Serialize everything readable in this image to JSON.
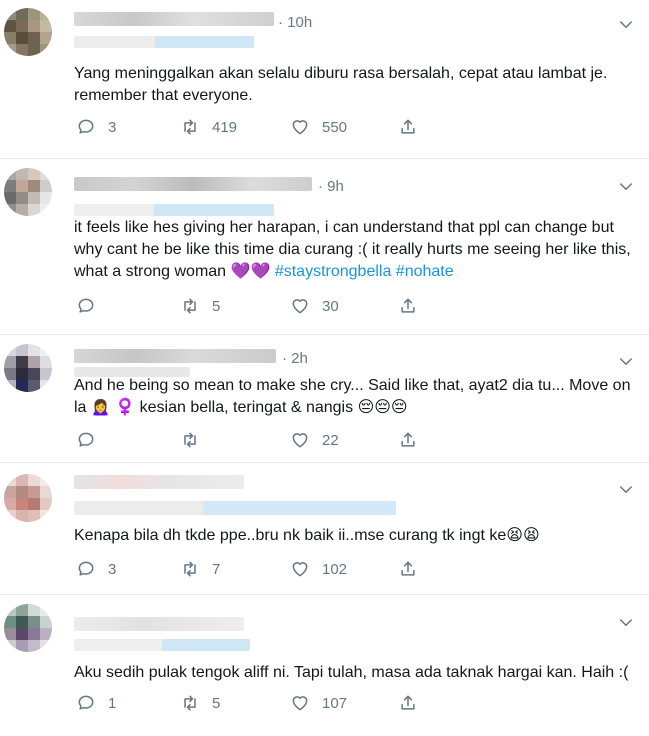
{
  "tweets": [
    {
      "time": "· 10h",
      "text": "Yang meninggalkan akan selalu diburu rasa bersalah, cepat atau lambat je. remember that everyone.",
      "hashtags": [],
      "emoji": "",
      "replies": "3",
      "retweets": "419",
      "likes": "550"
    },
    {
      "time": "· 9h",
      "text": "it feels like hes giving her harapan, i can understand that ppl can change but why cant he be like this time dia curang :( it really hurts me seeing her like this, what a strong woman",
      "hearts": "💜💜",
      "hashtags": [
        "#staystrongbella",
        "#nohate"
      ],
      "emoji": "",
      "replies": "",
      "retweets": "5",
      "likes": "30"
    },
    {
      "time": "· 2h",
      "text": "And he being so mean to make she cry... Said like that, ayat2 dia tu... Move on la 🙍‍♀️ ♀️ kesian bella, teringat & nangis",
      "hashtags": [],
      "emoji": "😔😔😔",
      "replies": "",
      "retweets": "",
      "likes": "22"
    },
    {
      "time": "",
      "text": "Kenapa bila dh tkde ppe..bru nk baik ii..mse curang tk ingt ke",
      "hashtags": [],
      "emoji": "😫😫",
      "replies": "3",
      "retweets": "7",
      "likes": "102"
    },
    {
      "time": "",
      "text": "Aku sedih pulak tengok aliff ni. Tapi tulah, masa ada taknak hargai kan. Haih :(",
      "hashtags": [],
      "emoji": "",
      "replies": "1",
      "retweets": "5",
      "likes": "107"
    }
  ],
  "colors": {
    "text": "#14171a",
    "secondary": "#657786",
    "link": "#1b95e0",
    "divider": "#e6ecf0"
  },
  "icons": [
    "reply-icon",
    "retweet-icon",
    "like-icon",
    "share-icon",
    "chevron-down-icon"
  ]
}
